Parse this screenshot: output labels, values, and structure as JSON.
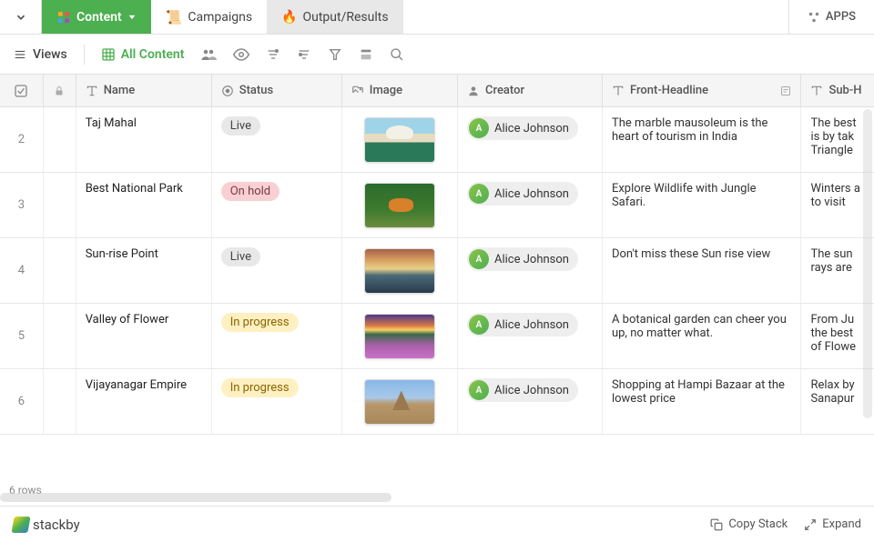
{
  "topnav": {
    "content_label": "Content",
    "campaigns_label": "Campaigns",
    "output_label": "Output/Results",
    "apps_label": "APPS"
  },
  "toolbar": {
    "views_label": "Views",
    "allcontent_label": "All Content"
  },
  "columns": {
    "name": "Name",
    "status": "Status",
    "image": "Image",
    "creator": "Creator",
    "front": "Front-Headline",
    "sub": "Sub-H"
  },
  "rows": [
    {
      "num": "2",
      "name": "Taj Mahal",
      "status": "Live",
      "thumb": "taj",
      "creator": "Alice Johnson",
      "front": "The marble mausoleum is the heart of tourism in India",
      "sub": "The best is by tak Triangle"
    },
    {
      "num": "3",
      "name": "Best National Park",
      "status": "On hold",
      "thumb": "tiger",
      "creator": "Alice Johnson",
      "front": "Explore Wildlife with Jungle Safari.",
      "sub": "Winters a to visit"
    },
    {
      "num": "4",
      "name": "Sun-rise Point",
      "status": "Live",
      "thumb": "sunrise",
      "creator": "Alice Johnson",
      "front": "Don't miss these Sun rise view",
      "sub": "The sun rays are"
    },
    {
      "num": "5",
      "name": "Valley of Flower",
      "status": "In progress",
      "thumb": "valley",
      "creator": "Alice Johnson",
      "front": "A botanical garden can cheer you up, no matter what.",
      "sub": "From Ju the best of Flowe"
    },
    {
      "num": "6",
      "name": "Vijayanagar Empire",
      "status": "In progress",
      "thumb": "empire",
      "creator": "Alice Johnson",
      "front": "Shopping at Hampi Bazaar at the lowest price",
      "sub": "Relax by Sanapur"
    }
  ],
  "rowcount": "6 rows",
  "footer": {
    "brand": "stackby",
    "copy": "Copy Stack",
    "expand": "Expand"
  }
}
